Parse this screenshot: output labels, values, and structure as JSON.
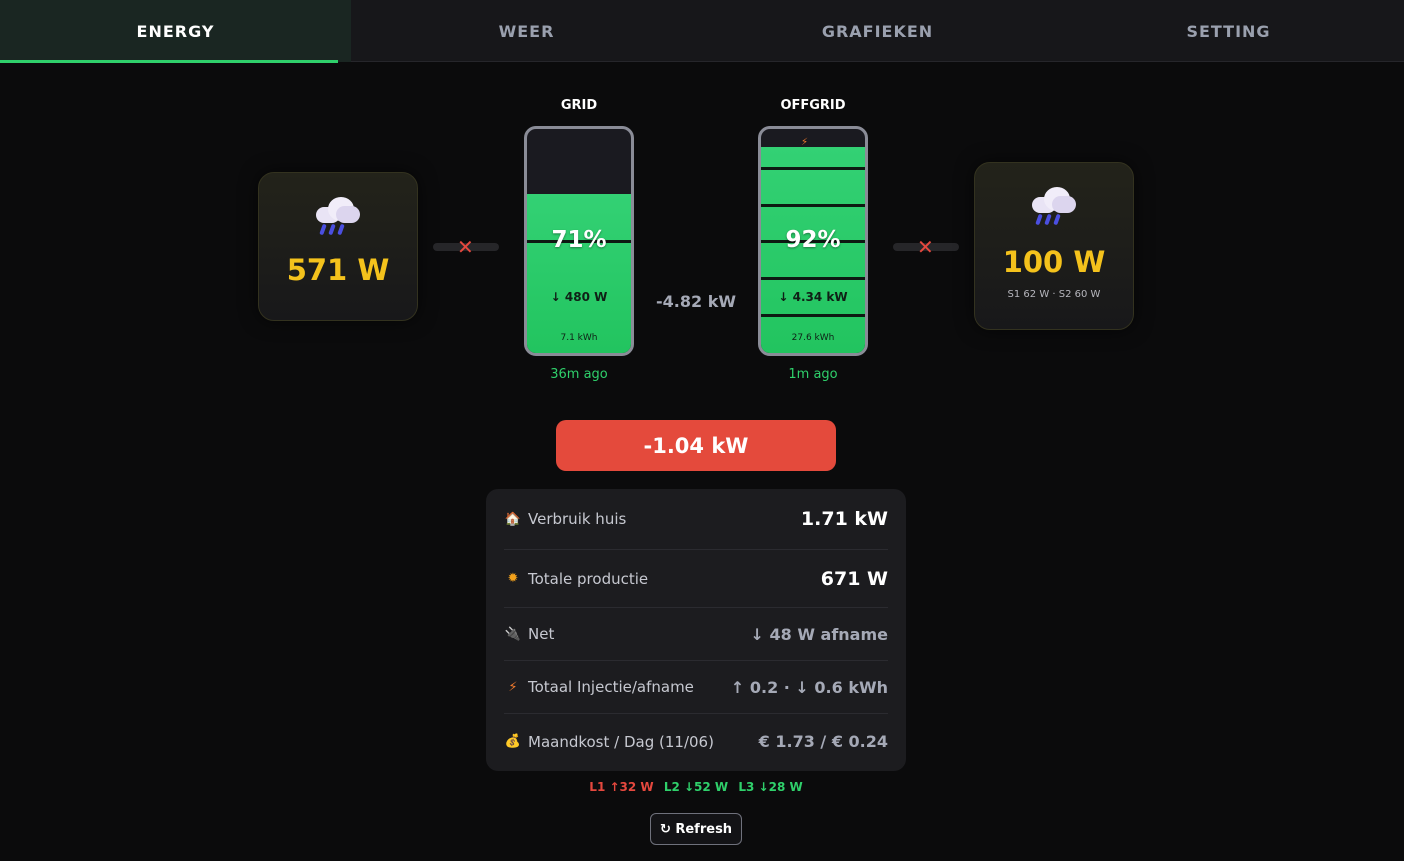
{
  "tabs": [
    {
      "label": "ENERGY",
      "active": true
    },
    {
      "label": "WEER",
      "active": false
    },
    {
      "label": "GRAFIEKEN",
      "active": false
    },
    {
      "label": "SETTING",
      "active": false
    }
  ],
  "solar_left": {
    "icon": "rain-cloud-icon",
    "value": "571 W"
  },
  "solar_right": {
    "icon": "rain-cloud-icon",
    "value": "100 W",
    "sub": "S1 62 W · S2 60 W"
  },
  "grid_battery": {
    "title": "GRID",
    "level": 0.71,
    "percent": "71%",
    "power": "↓ 480 W",
    "energy": "7.1 kWh",
    "updated": "36m ago"
  },
  "offgrid_battery": {
    "title": "OFFGRID",
    "level": 0.92,
    "percent": "92%",
    "power": "↓ 4.34 kW",
    "energy": "27.6 kWh",
    "updated": "1m ago"
  },
  "battery_flow": "-4.82 kW",
  "net_power": "-1.04 kW",
  "stats": {
    "consumption": {
      "icon": "house-icon",
      "label": "Verbruik huis",
      "value": "1.71 kW"
    },
    "production": {
      "icon": "sun-icon",
      "label": "Totale productie",
      "value": "671 W"
    },
    "grid": {
      "icon": "plug-icon",
      "label": "Net",
      "value": "↓ 48 W afname"
    },
    "injection": {
      "icon": "bolt-icon",
      "label": "Totaal Injectie/afname",
      "value": "↑ 0.2 · ↓ 0.6 kWh"
    },
    "cost": {
      "icon": "money-bag-icon",
      "label": "Maandkost / Dag (11/06)",
      "value": "€ 1.73 / € 0.24"
    }
  },
  "phases": [
    {
      "label": "L1 ↑32 W",
      "color": "#e5483e"
    },
    {
      "label": "L2 ↓52 W",
      "color": "#2fd06b"
    },
    {
      "label": "L3 ↓28 W",
      "color": "#2fd06b"
    }
  ],
  "refresh_label": "↻ Refresh",
  "colors": {
    "accent": "#2fd06b",
    "solar": "#f4c21c",
    "alert": "#e44a3c"
  }
}
